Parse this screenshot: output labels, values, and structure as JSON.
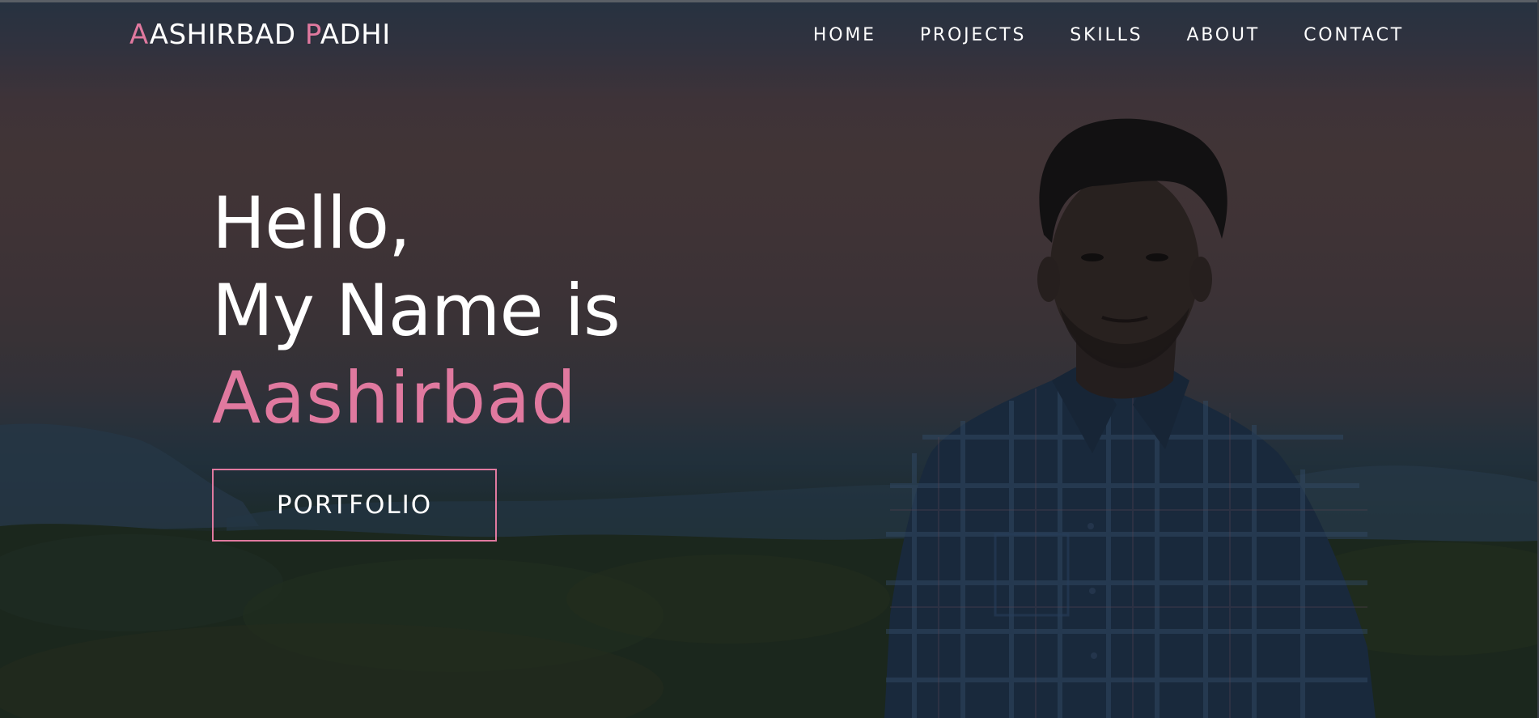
{
  "navbar": {
    "logo": {
      "first_initial": "A",
      "first_rest": "ASHIRBAD",
      "last_initial": "P",
      "last_rest": "ADHI"
    },
    "links": [
      {
        "label": "HOME"
      },
      {
        "label": "PROJECTS"
      },
      {
        "label": "SKILLS"
      },
      {
        "label": "ABOUT"
      },
      {
        "label": "CONTACT"
      }
    ]
  },
  "hero": {
    "greeting_line1": "Hello,",
    "greeting_line2": "My Name is",
    "name": "Aashirbad",
    "button_label": "PORTFOLIO"
  },
  "colors": {
    "accent": "#e0799f",
    "text": "#ffffff"
  }
}
